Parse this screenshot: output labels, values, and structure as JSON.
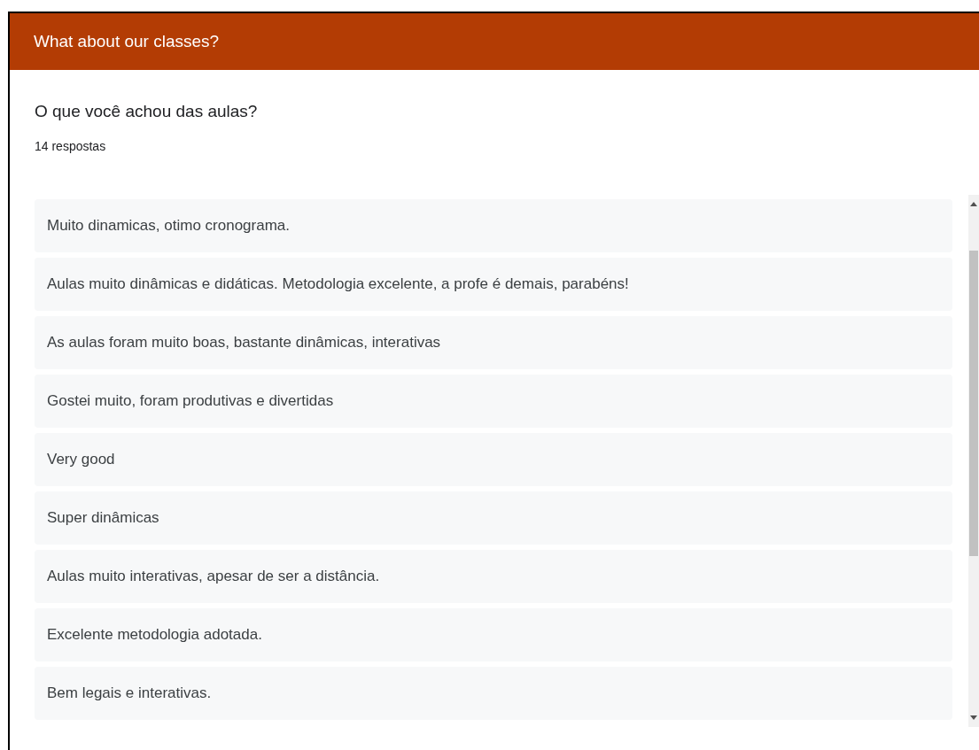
{
  "header": {
    "title": "What about our classes?"
  },
  "question": {
    "title": "O que você achou das aulas?",
    "count": "14 respostas"
  },
  "responses": [
    {
      "text": "Muito dinamicas, otimo cronograma."
    },
    {
      "text": "Aulas muito dinâmicas e didáticas. Metodologia excelente, a profe é demais, parabéns!"
    },
    {
      "text": "As aulas foram muito boas, bastante dinâmicas, interativas"
    },
    {
      "text": "Gostei muito, foram produtivas e divertidas"
    },
    {
      "text": "Very good"
    },
    {
      "text": "Super dinâmicas"
    },
    {
      "text": "Aulas muito interativas, apesar de ser a distância."
    },
    {
      "text": "Excelente metodologia adotada."
    },
    {
      "text": "Bem legais e interativas."
    }
  ]
}
